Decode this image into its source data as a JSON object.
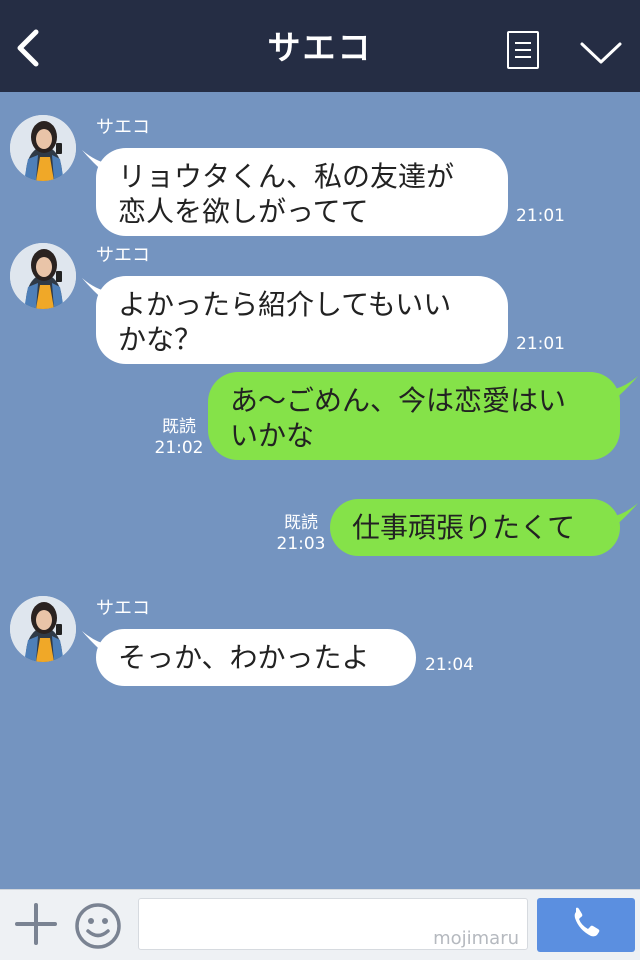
{
  "header": {
    "title": "サエコ",
    "back_icon": "chevron-left-icon",
    "menu_icon": "list-icon",
    "collapse_icon": "chevron-down-icon",
    "background": "#252d44"
  },
  "chat": {
    "background": "#7494c0",
    "messages": [
      {
        "direction": "incoming",
        "sender": "サエコ",
        "text": "リョウタくん、私の友達が\n恋人を欲しがってて",
        "time": "21:01"
      },
      {
        "direction": "incoming",
        "sender": "サエコ",
        "text": "よかったら紹介してもいい\nかな？",
        "time": "21:01"
      },
      {
        "direction": "outgoing",
        "text": "あ〜ごめん、今は恋愛はい\nいかな",
        "read": "既読",
        "time": "21:02"
      },
      {
        "direction": "outgoing",
        "text": "仕事頑張りたくて",
        "read": "既読",
        "time": "21:03"
      },
      {
        "direction": "incoming",
        "sender": "サエコ",
        "text": "そっか、わかったよ",
        "time": "21:04"
      }
    ],
    "incoming_bubble_color": "#ffffff",
    "outgoing_bubble_color": "#85e249"
  },
  "footer": {
    "plus_icon": "plus-icon",
    "emoji_icon": "smiley-icon",
    "input_value": "",
    "watermark": "mojimaru",
    "call_icon": "phone-icon",
    "call_button_color": "#5b8fe0"
  }
}
